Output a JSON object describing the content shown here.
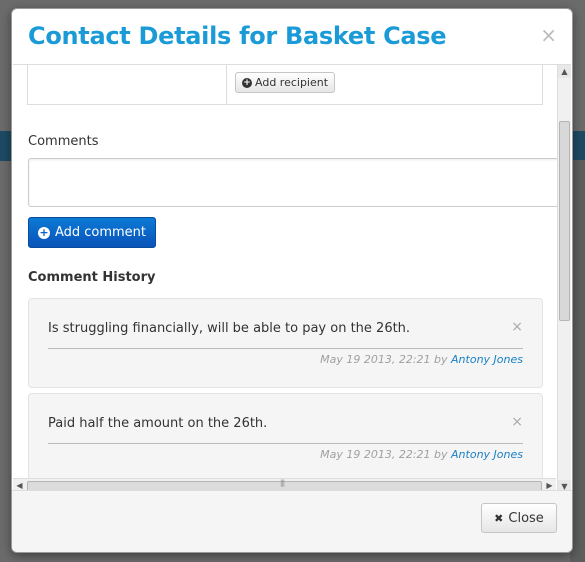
{
  "modal": {
    "title": "Contact Details for Basket Case",
    "close_glyph": "×"
  },
  "recipients": {
    "add_button_label": "Add recipient",
    "add_icon": "plus-circle-icon"
  },
  "comments": {
    "label": "Comments",
    "textarea_value": "",
    "add_button_label": "Add comment",
    "add_icon": "plus-circle-icon"
  },
  "history": {
    "title": "Comment History",
    "items": [
      {
        "text": "Is struggling financially, will be able to pay on the 26th.",
        "date": "May 19 2013, 22:21",
        "by": "by",
        "author": "Antony Jones",
        "remove_glyph": "×"
      },
      {
        "text": "Paid half the amount on the 26th.",
        "date": "May 19 2013, 22:21",
        "by": "by",
        "author": "Antony Jones",
        "remove_glyph": "×"
      }
    ]
  },
  "footer": {
    "close_label": "Close",
    "close_icon": "x-icon",
    "close_glyph": "✖"
  },
  "colors": {
    "title": "#1a9bd7",
    "primary_button": "#0a63c6",
    "author_link": "#1a80c4"
  }
}
